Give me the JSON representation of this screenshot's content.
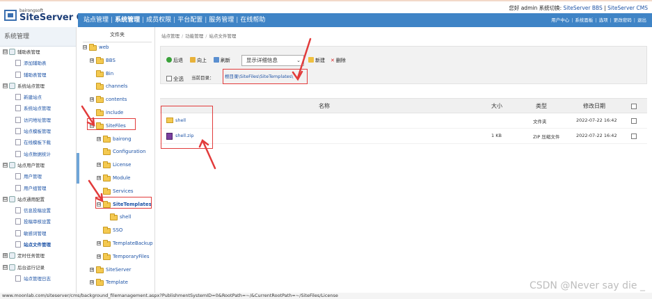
{
  "header": {
    "logo_small": "bairongsoft",
    "logo_big": "SiteServer CMS",
    "welcome": "您好 admin  系统切换:",
    "switch_bbs": "SiteServer BBS",
    "switch_sep": "|",
    "switch_cms": "SiteServer CMS"
  },
  "nav": {
    "items": [
      "站点管理",
      "系统管理",
      "成员权限",
      "平台配置",
      "服务管理",
      "在线帮助"
    ],
    "right": [
      "用户中心",
      "系统面板",
      "选项",
      "更改密码",
      "退出"
    ]
  },
  "leftmenu": {
    "title": "系统管理",
    "items": [
      {
        "label": "辅助表管理",
        "type": "group",
        "toggle": "⊟"
      },
      {
        "label": "添加辅助表",
        "type": "sub"
      },
      {
        "label": "辅助表管理",
        "type": "sub"
      },
      {
        "label": "系统站点管理",
        "type": "group",
        "toggle": "⊟"
      },
      {
        "label": "新建站点",
        "type": "sub"
      },
      {
        "label": "系统站点管理",
        "type": "sub"
      },
      {
        "label": "访问地址管理",
        "type": "sub"
      },
      {
        "label": "站点模板管理",
        "type": "sub"
      },
      {
        "label": "在线模板下载",
        "type": "sub"
      },
      {
        "label": "站点数据统计",
        "type": "sub"
      },
      {
        "label": "站点用户管理",
        "type": "group",
        "toggle": "⊟"
      },
      {
        "label": "用户管理",
        "type": "sub"
      },
      {
        "label": "用户组管理",
        "type": "sub"
      },
      {
        "label": "站点通用配置",
        "type": "group",
        "toggle": "⊟"
      },
      {
        "label": "信息投稿设置",
        "type": "sub"
      },
      {
        "label": "投稿审核设置",
        "type": "sub"
      },
      {
        "label": "敏感词管理",
        "type": "sub"
      },
      {
        "label": "站点文件管理",
        "type": "sub",
        "current": true
      },
      {
        "label": "定时任务管理",
        "type": "group",
        "toggle": "⊞"
      },
      {
        "label": "后台运行记录",
        "type": "group",
        "toggle": "⊟"
      },
      {
        "label": "站点管理日志",
        "type": "sub"
      }
    ]
  },
  "tree": {
    "title": "文件夹",
    "nodes": [
      {
        "label": "web",
        "toggle": "⊟",
        "level": 0
      },
      {
        "label": "BBS",
        "toggle": "⊞",
        "level": 1
      },
      {
        "label": "Bin",
        "toggle": "",
        "level": 1
      },
      {
        "label": "channels",
        "toggle": "",
        "level": 1
      },
      {
        "label": "contents",
        "toggle": "⊞",
        "level": 1
      },
      {
        "label": "include",
        "toggle": "",
        "level": 1
      },
      {
        "label": "SiteFiles",
        "toggle": "⊟",
        "level": 1
      },
      {
        "label": "bairong",
        "toggle": "⊞",
        "level": 2
      },
      {
        "label": "Configuration",
        "toggle": "",
        "level": 2
      },
      {
        "label": "License",
        "toggle": "⊞",
        "level": 2
      },
      {
        "label": "Module",
        "toggle": "⊞",
        "level": 2
      },
      {
        "label": "Services",
        "toggle": "",
        "level": 2
      },
      {
        "label": "SiteTemplates",
        "toggle": "⊟",
        "level": 2,
        "current": true
      },
      {
        "label": "shell",
        "toggle": "",
        "level": 3
      },
      {
        "label": "SSO",
        "toggle": "",
        "level": 2
      },
      {
        "label": "TemplateBackup",
        "toggle": "⊞",
        "level": 2
      },
      {
        "label": "TemporaryFiles",
        "toggle": "⊞",
        "level": 2
      },
      {
        "label": "SiteServer",
        "toggle": "⊞",
        "level": 1
      },
      {
        "label": "Template",
        "toggle": "⊞",
        "level": 1
      }
    ]
  },
  "main": {
    "breadcrumb": [
      "站点管理",
      "功能管理",
      "站点文件管理"
    ],
    "toolbar": {
      "back": "后退",
      "up": "向上",
      "refresh": "刷新",
      "view_select": "显示详细信息",
      "new": "新建",
      "delete": "删除",
      "select_all": "全选",
      "current_dir_label": "当前目录：",
      "current_dir": "根目录\\SiteFiles\\SiteTemplates\\"
    },
    "columns": [
      "名称",
      "大小",
      "类型",
      "修改日期"
    ],
    "rows": [
      {
        "name": "shell",
        "size": "",
        "type": "文件夹",
        "date": "2022-07-22 16:42",
        "icon": "folder-icon"
      },
      {
        "name": "shell.zip",
        "size": "1 KB",
        "type": "ZIP 压缩文件",
        "date": "2022-07-22 16:42",
        "icon": "zip-icon"
      }
    ]
  },
  "status_bar": "www.moonlab.com/siteserver/cms/background_filemanagement.aspx?PublishmentSystemID=0&RootPath=~/&CurrentRootPath=~/SiteFiles/License",
  "watermark": "CSDN @Never say die _",
  "colors": {
    "nav_blue": "#3f84c6",
    "link_blue": "#1d53a6",
    "annotation_red": "#e23b3b",
    "folder_yellow": "#f4c950"
  }
}
